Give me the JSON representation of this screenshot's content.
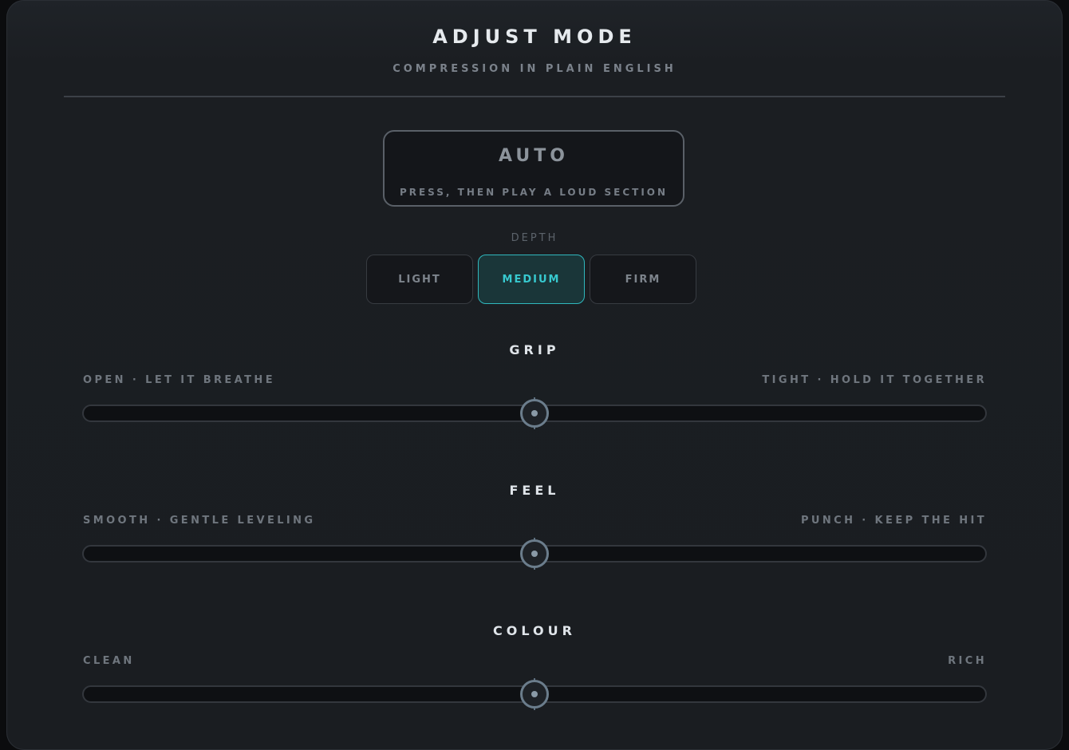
{
  "header": {
    "title": "ADJUST MODE",
    "subtitle": "COMPRESSION IN PLAIN ENGLISH"
  },
  "auto_button": {
    "label": "AUTO",
    "hint": "PRESS, THEN PLAY A LOUD SECTION"
  },
  "depth": {
    "label": "DEPTH",
    "options": [
      "LIGHT",
      "MEDIUM",
      "FIRM"
    ],
    "selected": "MEDIUM"
  },
  "sliders": [
    {
      "title": "GRIP",
      "left_label": "OPEN · LET IT BREATHE",
      "right_label": "TIGHT · HOLD IT TOGETHER",
      "value": 0.5
    },
    {
      "title": "FEEL",
      "left_label": "SMOOTH · GENTLE LEVELING",
      "right_label": "PUNCH · KEEP THE HIT",
      "value": 0.5
    },
    {
      "title": "COLOUR",
      "left_label": "CLEAN",
      "right_label": "RICH",
      "value": 0.5
    }
  ],
  "colors": {
    "accent": "#2fb7bd",
    "panel": "#1b1e22",
    "text": "#dfe4e9",
    "muted": "#6f767e"
  }
}
